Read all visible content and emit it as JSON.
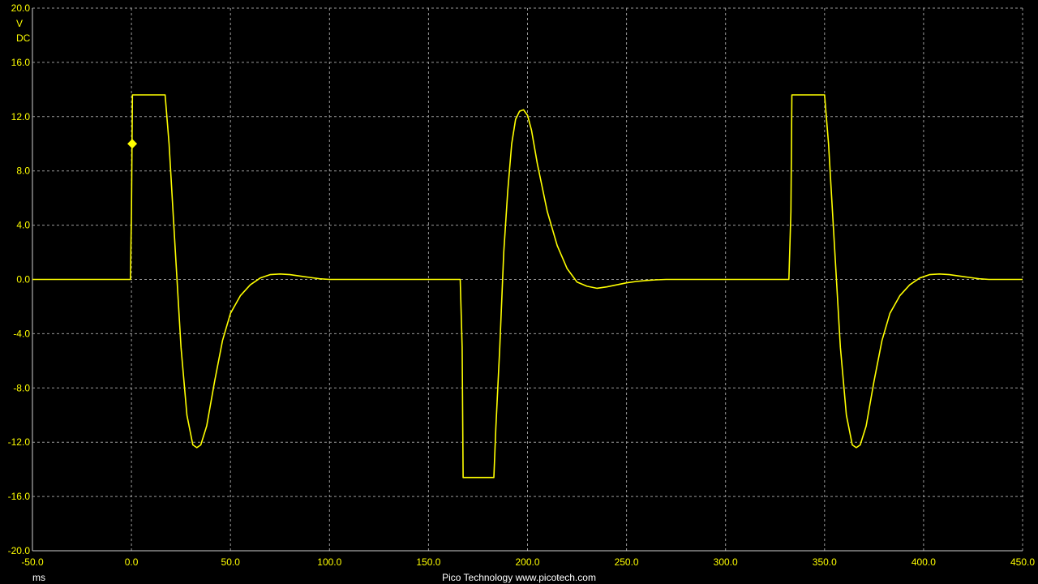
{
  "chart_data": {
    "type": "line",
    "title": "",
    "xlabel": "ms",
    "ylabel": "V",
    "y_coupling": "DC",
    "xlim": [
      -50,
      450
    ],
    "ylim": [
      -20,
      20
    ],
    "grid": true,
    "x_ticks": [
      "-50.0",
      "0.0",
      "50.0",
      "100.0",
      "150.0",
      "200.0",
      "250.0",
      "300.0",
      "350.0",
      "400.0",
      "450.0"
    ],
    "y_ticks": [
      "20.0",
      "16.0",
      "12.0",
      "8.0",
      "4.0",
      "0.0",
      "-4.0",
      "-8.0",
      "-12.0",
      "-16.0",
      "-20.0"
    ],
    "trigger_marker": {
      "x": 0,
      "y": 10
    },
    "colors": {
      "trace": "#ffff00",
      "grid": "#9a9a9a",
      "background": "#000000"
    },
    "series": [
      {
        "x": [
          -50,
          -0.5,
          0,
          0.5,
          17,
          19,
          22,
          25,
          28,
          31,
          33,
          35,
          38,
          42,
          46,
          50,
          55,
          60,
          65,
          70,
          75,
          80,
          85,
          90,
          95,
          100,
          166,
          167,
          167.5,
          183,
          184,
          186,
          188,
          190,
          192,
          194,
          196,
          198,
          200,
          202,
          205,
          210,
          215,
          220,
          225,
          230,
          235,
          240,
          245,
          250,
          255,
          260,
          265,
          270,
          300,
          332,
          333,
          333.5,
          350,
          352,
          355,
          358,
          361,
          364,
          366,
          368,
          371,
          375,
          379,
          383,
          388,
          393,
          398,
          403,
          408,
          413,
          418,
          423,
          428,
          433,
          450
        ],
        "y": [
          0,
          0,
          5,
          13.6,
          13.6,
          10,
          2.5,
          -5,
          -10,
          -12.2,
          -12.4,
          -12.2,
          -10.8,
          -7.5,
          -4.5,
          -2.5,
          -1.2,
          -0.4,
          0.1,
          0.35,
          0.4,
          0.35,
          0.25,
          0.15,
          0.05,
          0,
          0,
          -5,
          -14.6,
          -14.6,
          -11,
          -5,
          2,
          6.5,
          10,
          11.8,
          12.4,
          12.5,
          12.1,
          11,
          8.5,
          5,
          2.5,
          0.8,
          -0.2,
          -0.5,
          -0.65,
          -0.55,
          -0.4,
          -0.25,
          -0.15,
          -0.08,
          -0.03,
          0,
          0,
          0,
          5,
          13.6,
          13.6,
          10,
          2.5,
          -5,
          -10,
          -12.2,
          -12.4,
          -12.2,
          -10.8,
          -7.5,
          -4.5,
          -2.5,
          -1.2,
          -0.4,
          0.1,
          0.35,
          0.4,
          0.35,
          0.25,
          0.15,
          0.05,
          0,
          0
        ]
      }
    ]
  },
  "footer": {
    "x_unit": "ms",
    "branding": "Pico Technology   www.picotech.com"
  }
}
